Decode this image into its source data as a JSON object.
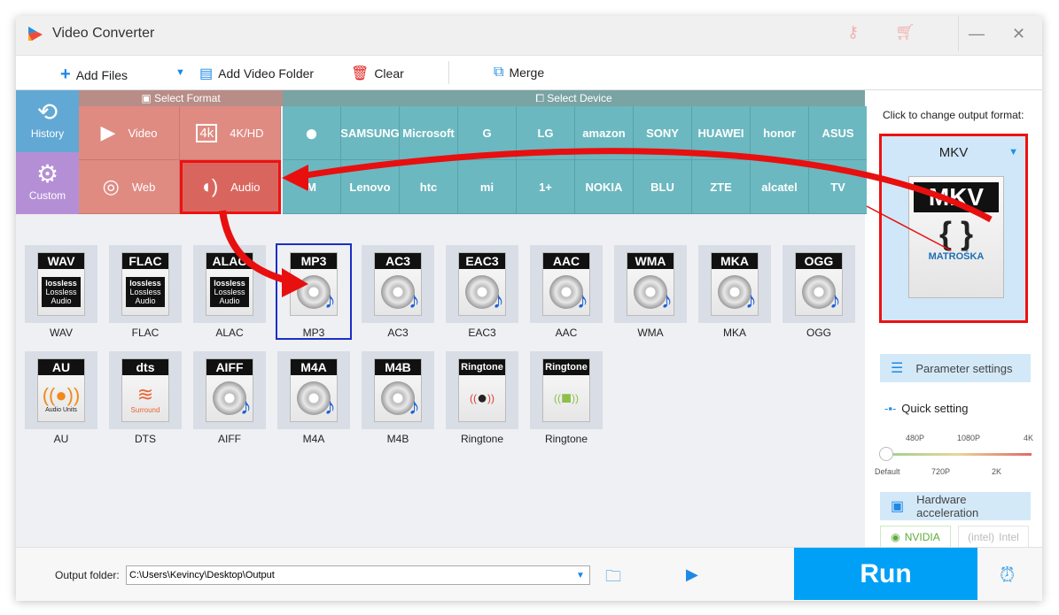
{
  "window": {
    "title": "Video Converter",
    "icons": [
      "key-icon",
      "cart-icon"
    ],
    "minimize": "—",
    "close": "✕"
  },
  "toolbar": {
    "add_files": "Add Files",
    "add_video_folder": "Add Video Folder",
    "clear": "Clear",
    "merge": "Merge"
  },
  "side": {
    "history": "History",
    "custom": "Custom"
  },
  "format_panel": {
    "header": "Select Format",
    "items": [
      {
        "label": "Video",
        "icon": "▶"
      },
      {
        "label": "4K/HD",
        "icon": "4k"
      },
      {
        "label": "Web",
        "icon": "◎"
      },
      {
        "label": "Audio",
        "icon": "🔈",
        "selected": true
      }
    ]
  },
  "device_panel": {
    "header": "Select Device",
    "row1": [
      "",
      "SAMSUNG",
      "Microsoft",
      "G",
      "LG",
      "amazon",
      "SONY",
      "HUAWEI",
      "honor",
      "ASUS"
    ],
    "row2": [
      "M",
      "Lenovo",
      "htc",
      "mi",
      "1+",
      "NOKIA",
      "BLU",
      "ZTE",
      "alcatel",
      "TV"
    ]
  },
  "formats": [
    {
      "band": "WAV",
      "label": "WAV",
      "art": "lossless"
    },
    {
      "band": "FLAC",
      "label": "FLAC",
      "art": "lossless"
    },
    {
      "band": "ALAC",
      "label": "ALAC",
      "art": "lossless"
    },
    {
      "band": "MP3",
      "label": "MP3",
      "art": "disc",
      "selected": true
    },
    {
      "band": "AC3",
      "label": "AC3",
      "art": "disc"
    },
    {
      "band": "EAC3",
      "label": "EAC3",
      "art": "disc"
    },
    {
      "band": "AAC",
      "label": "AAC",
      "art": "disc"
    },
    {
      "band": "WMA",
      "label": "WMA",
      "art": "disc"
    },
    {
      "band": "MKA",
      "label": "MKA",
      "art": "disc"
    },
    {
      "band": "OGG",
      "label": "OGG",
      "art": "disc"
    },
    {
      "band": "AU",
      "label": "AU",
      "art": "au"
    },
    {
      "band": "dts",
      "label": "DTS",
      "art": "dts"
    },
    {
      "band": "AIFF",
      "label": "AIFF",
      "art": "disc"
    },
    {
      "band": "M4A",
      "label": "M4A",
      "art": "disc"
    },
    {
      "band": "M4B",
      "label": "M4B",
      "art": "disc"
    },
    {
      "band": "Ringtone",
      "label": "Ringtone",
      "art": "apple"
    },
    {
      "band": "Ringtone",
      "label": "Ringtone",
      "art": "android"
    }
  ],
  "lossless_text": [
    "lossless",
    "Lossless",
    "Audio"
  ],
  "au_text": "Audio Units",
  "dts_text": "Surround",
  "right_panel": {
    "hint": "Click to change output format:",
    "output_format": "MKV",
    "output_brand": "MATROŠKA",
    "parameter_settings": "Parameter settings",
    "quick_setting": "Quick setting",
    "ticks_top": [
      "480P",
      "1080P",
      "4K"
    ],
    "ticks_bottom": [
      "Default",
      "720P",
      "2K"
    ],
    "quality_value": "Default",
    "hardware_acceleration": "Hardware acceleration",
    "nvidia": "NVIDIA",
    "intel": "Intel"
  },
  "bottom": {
    "output_folder_label": "Output folder:",
    "output_folder_value": "C:\\Users\\Kevincy\\Desktop\\Output",
    "run": "Run"
  }
}
